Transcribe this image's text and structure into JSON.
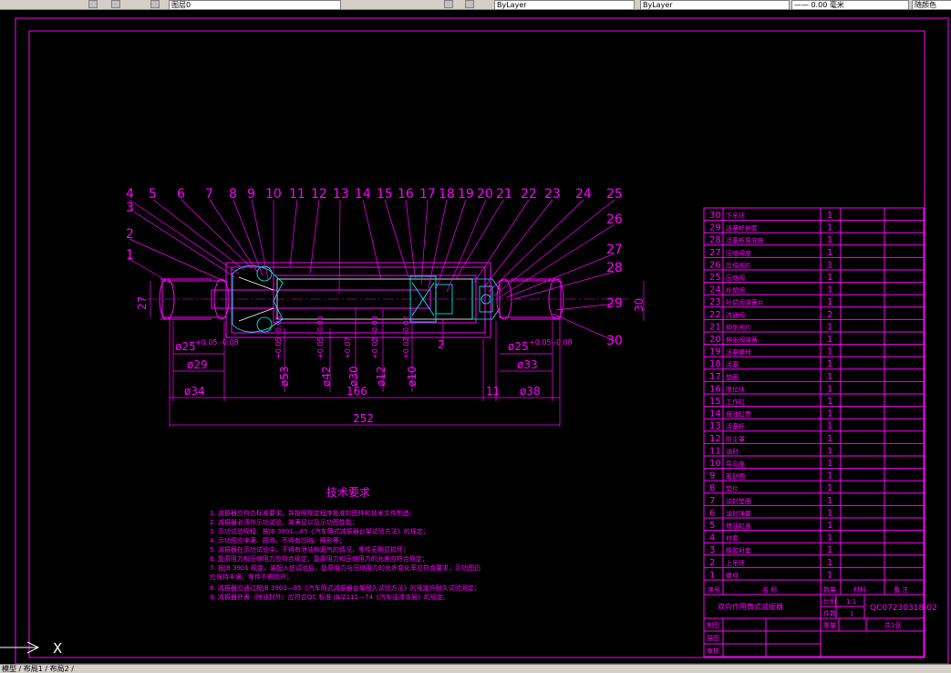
{
  "toolbar": {
    "layer_field": "图层0",
    "bylayer_1": "ByLayer",
    "bylayer_2": "ByLayer",
    "lineweight": "—— 0.00 毫米",
    "color_field": "随颜色"
  },
  "status": {
    "coords": "模型 / 布局1 / 布局2 /"
  },
  "ucs": {
    "x_label": "X"
  },
  "drawing": {
    "part_numbers_top": [
      "4",
      "5",
      "6",
      "7",
      "8",
      "9",
      "10",
      "11",
      "12",
      "13",
      "14",
      "15",
      "16",
      "17",
      "18",
      "19",
      "20",
      "21",
      "22",
      "23",
      "24",
      "25"
    ],
    "part_numbers_left": [
      "3",
      "2",
      "1"
    ],
    "part_numbers_right": [
      "26",
      "27",
      "28",
      "29",
      "30"
    ],
    "dims": {
      "d27": "27",
      "d30": "30",
      "d25_left": "ø25",
      "d25_left_tol": "+0.05 -0.08",
      "d25_right": "ø25",
      "d25_right_tol": "+0.05 -0.08",
      "d29": "ø29",
      "d33": "ø33",
      "d34": "ø34",
      "d38": "ø38",
      "d166": "166",
      "d11": "11",
      "d252": "252",
      "d2": "2",
      "v53": "ø53",
      "v53_tol": "+0.05 -0.08",
      "v42": "ø42",
      "v42_tol": "+0.05 -0.08",
      "v30": "ø30",
      "v30_tol": "+0.07",
      "v12": "ø12",
      "v12_tol": "+0.02 -0.08",
      "v10": "ø10",
      "v10_tol": "+0.02 -0.02"
    },
    "tech_title": "技术要求",
    "tech_lines": [
      "1. 减振器应符合标准要求，并按照规定程序批准的图样和技术文件制造；",
      "2. 减振器必须作示功试验，并满足以及示功图性能；",
      "3. 示功试验规程：按JB 3901—85《汽车筒式减振器台架试验方法》的规定；",
      "4. 示功图应丰满、圆滑，不得有凹陷、畸形等；",
      "5. 减振器在示功试验中，不得有泄油和漏气的情况，零件无明显损坏；",
      "6. 复原阻力和压缩阻力应符合规定，复原阻力和压缩阻力的允差应符合规定；",
      "7. 按JB 3901 规定，装配入住试验后，复原阻力与压缩阻力的允许变化率应符合要求，示功图仍",
      "   应保持丰满，零件不得损坏；",
      "8. 减振器应通过按JB 3902—85《汽车筒式减振器台架耐久试验方法》的规定作耐久试验测定；",
      "9. 减振器外表（除油封外）应符合QC 标准 JB/Z111—74《汽车油漆涂层》的规定。"
    ]
  },
  "parts_table": {
    "rows": [
      {
        "no": "30",
        "name": "下吊环",
        "qty": "1"
      },
      {
        "no": "29",
        "name": "活塞杆护套",
        "qty": "1"
      },
      {
        "no": "28",
        "name": "活塞杆导向座",
        "qty": "1"
      },
      {
        "no": "27",
        "name": "压缩阀座",
        "qty": "1"
      },
      {
        "no": "26",
        "name": "压缩阀片",
        "qty": "1"
      },
      {
        "no": "25",
        "name": "压缩阀",
        "qty": "1"
      },
      {
        "no": "24",
        "name": "补偿阀",
        "qty": "1"
      },
      {
        "no": "23",
        "name": "补偿阀弹簧片",
        "qty": "1"
      },
      {
        "no": "22",
        "name": "流通阀",
        "qty": "2"
      },
      {
        "no": "21",
        "name": "伸张阀片",
        "qty": "1"
      },
      {
        "no": "20",
        "name": "伸张阀弹簧",
        "qty": "1"
      },
      {
        "no": "19",
        "name": "活塞螺母",
        "qty": "1"
      },
      {
        "no": "18",
        "name": "活塞",
        "qty": "1"
      },
      {
        "no": "17",
        "name": "垫圈",
        "qty": "1"
      },
      {
        "no": "16",
        "name": "限位块",
        "qty": "1"
      },
      {
        "no": "15",
        "name": "工作缸",
        "qty": "1"
      },
      {
        "no": "14",
        "name": "储油缸筒",
        "qty": "1"
      },
      {
        "no": "13",
        "name": "活塞杆",
        "qty": "1"
      },
      {
        "no": "12",
        "name": "防尘罩",
        "qty": "1"
      },
      {
        "no": "11",
        "name": "油封",
        "qty": "1"
      },
      {
        "no": "10",
        "name": "导向座",
        "qty": "1"
      },
      {
        "no": "9",
        "name": "密封圈",
        "qty": "1"
      },
      {
        "no": "8",
        "name": "垫片",
        "qty": "1"
      },
      {
        "no": "7",
        "name": "油封垫圈",
        "qty": "1"
      },
      {
        "no": "6",
        "name": "油封弹簧",
        "qty": "1"
      },
      {
        "no": "5",
        "name": "储油缸盖",
        "qty": "1"
      },
      {
        "no": "4",
        "name": "衬套",
        "qty": "1"
      },
      {
        "no": "3",
        "name": "橡胶衬套",
        "qty": "1"
      },
      {
        "no": "2",
        "name": "上吊环",
        "qty": "1"
      },
      {
        "no": "1",
        "name": "螺母",
        "qty": "1"
      }
    ],
    "header": {
      "no": "序号",
      "name": "名 称",
      "qty": "数量",
      "material": "材料",
      "remark": "备 注"
    },
    "title_block": {
      "title": "双向作用筒式减振器",
      "scale_label": "比例",
      "scale_value": "1:1",
      "count_label": "件数",
      "count_value": "1",
      "drawing_no": "QC07230318-02",
      "made_by": "制图",
      "weight": "重量",
      "sheet": "共1张",
      "drawn": "描图",
      "checked": "审核",
      "date": "日期"
    }
  }
}
